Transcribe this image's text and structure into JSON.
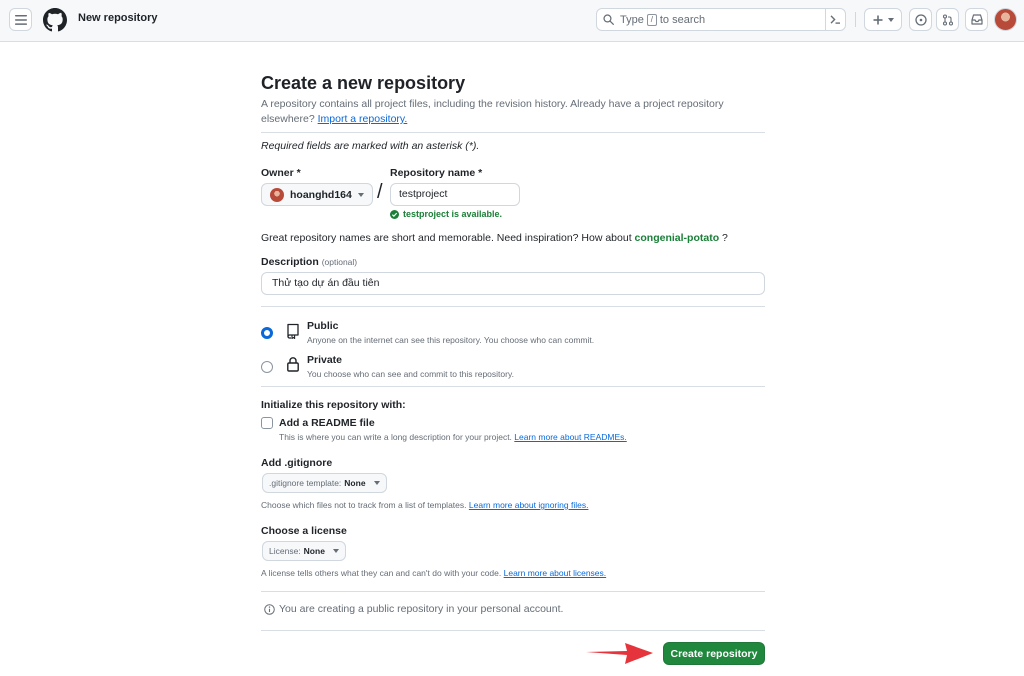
{
  "header": {
    "context_title": "New repository",
    "search": {
      "prefix": "Type",
      "key": "/",
      "suffix": "to search"
    }
  },
  "page": {
    "title": "Create a new repository",
    "subtitle": "A repository contains all project files, including the revision history. Already have a project repository elsewhere?",
    "import_link": "Import a repository.",
    "required_note": "Required fields are marked with an asterisk (*)."
  },
  "owner": {
    "label": "Owner *",
    "value": "hoanghd164"
  },
  "repository": {
    "label": "Repository name *",
    "value": "testproject",
    "availability": "testproject is available."
  },
  "inspiration": {
    "text": "Great repository names are short and memorable. Need inspiration? How about",
    "suggestion": "congenial-potato",
    "suffix": "?"
  },
  "description": {
    "label": "Description",
    "optional": "(optional)",
    "value": "Thử tạo dự án đầu tiên"
  },
  "visibility": {
    "selected": "public",
    "public": {
      "title": "Public",
      "desc": "Anyone on the internet can see this repository. You choose who can commit."
    },
    "private": {
      "title": "Private",
      "desc": "You choose who can see and commit to this repository."
    }
  },
  "initialize": {
    "title": "Initialize this repository with:",
    "readme": {
      "label": "Add a README file",
      "checked": false,
      "hint": "This is where you can write a long description for your project.",
      "link": "Learn more about READMEs."
    }
  },
  "gitignore": {
    "title": "Add .gitignore",
    "select_prefix": ".gitignore template:",
    "select_value": "None",
    "hint": "Choose which files not to track from a list of templates.",
    "link": "Learn more about ignoring files."
  },
  "license": {
    "title": "Choose a license",
    "select_prefix": "License:",
    "select_value": "None",
    "hint": "A license tells others what they can and can't do with your code.",
    "link": "Learn more about licenses."
  },
  "info": "You are creating a public repository in your personal account.",
  "submit_label": "Create repository",
  "colors": {
    "primary_button": "#1f883d",
    "link": "#0969da",
    "success": "#1a7f37",
    "annotation_arrow": "#e5343b"
  },
  "icons": [
    "hamburger-icon",
    "github-logo-icon",
    "search-icon",
    "command-palette-icon",
    "plus-icon",
    "issue-icon",
    "pull-request-icon",
    "inbox-icon",
    "check-circle-icon",
    "repo-icon",
    "lock-icon",
    "info-icon"
  ]
}
